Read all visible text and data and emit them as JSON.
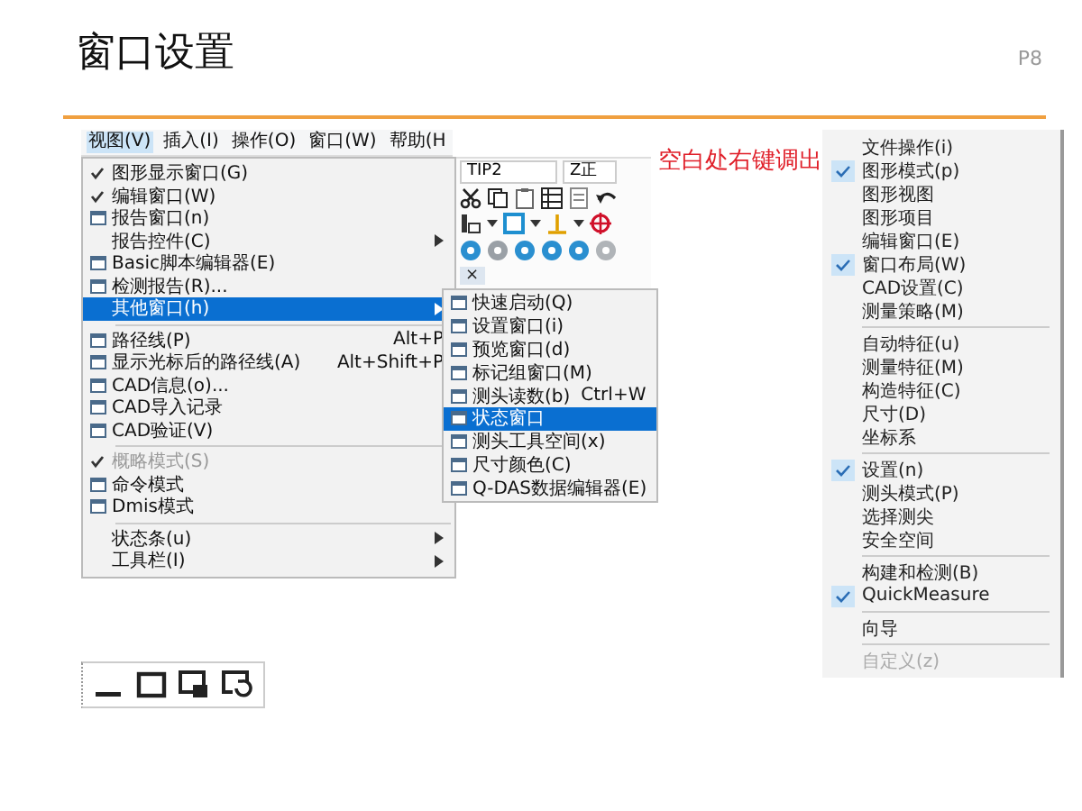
{
  "slide": {
    "title": "窗口设置",
    "page": "P8"
  },
  "app": {
    "menubar": [
      {
        "label": "视图(V)",
        "selected": true
      },
      {
        "label": "插入(I)",
        "selected": false
      },
      {
        "label": "操作(O)",
        "selected": false
      },
      {
        "label": "窗口(W)",
        "selected": false
      },
      {
        "label": "帮助(H",
        "selected": false
      }
    ],
    "toolbar": {
      "combo_1": "TIP2",
      "combo_2": "Z正",
      "close_tab": "×"
    },
    "view_menu": [
      {
        "kind": "item",
        "label": "图形显示窗口(G)",
        "checked": true,
        "selected": false,
        "disabled": false,
        "submenu": false
      },
      {
        "kind": "item",
        "label": "编辑窗口(W)",
        "checked": true,
        "selected": false,
        "disabled": false,
        "submenu": false
      },
      {
        "kind": "icon_item",
        "label": "报告窗口(n)",
        "checked": false,
        "selected": false,
        "disabled": false,
        "submenu": false
      },
      {
        "kind": "item",
        "label": "报告控件(C)",
        "checked": false,
        "selected": false,
        "disabled": false,
        "submenu": true
      },
      {
        "kind": "icon_item",
        "label": "Basic脚本编辑器(E)",
        "checked": false,
        "selected": false,
        "disabled": false,
        "submenu": false
      },
      {
        "kind": "icon_item",
        "label": "检测报告(R)...",
        "checked": false,
        "selected": false,
        "disabled": false,
        "submenu": false
      },
      {
        "kind": "item",
        "label": "其他窗口(h)",
        "checked": false,
        "selected": true,
        "disabled": false,
        "submenu": true
      },
      {
        "kind": "separator"
      },
      {
        "kind": "icon_item",
        "label": "路径线(P)",
        "shortcut": "Alt+P",
        "checked": false,
        "selected": false,
        "disabled": false,
        "submenu": false
      },
      {
        "kind": "icon_item",
        "label": "显示光标后的路径线(A)",
        "shortcut": "Alt+Shift+P",
        "checked": false,
        "selected": false,
        "disabled": false,
        "submenu": false
      },
      {
        "kind": "icon_item",
        "label": "CAD信息(o)...",
        "checked": false,
        "selected": false,
        "disabled": false,
        "submenu": false
      },
      {
        "kind": "icon_item",
        "label": "CAD导入记录",
        "checked": false,
        "selected": false,
        "disabled": false,
        "submenu": false
      },
      {
        "kind": "icon_item",
        "label": "CAD验证(V)",
        "checked": false,
        "selected": false,
        "disabled": false,
        "submenu": false
      },
      {
        "kind": "separator"
      },
      {
        "kind": "item",
        "label": "概略模式(S)",
        "checked": true,
        "selected": false,
        "disabled": true,
        "submenu": false
      },
      {
        "kind": "icon_item",
        "label": "命令模式",
        "checked": false,
        "selected": false,
        "disabled": false,
        "submenu": false
      },
      {
        "kind": "icon_item",
        "label": "Dmis模式",
        "checked": false,
        "selected": false,
        "disabled": false,
        "submenu": false
      },
      {
        "kind": "separator"
      },
      {
        "kind": "item",
        "label": "状态条(u)",
        "checked": false,
        "selected": false,
        "disabled": false,
        "submenu": true
      },
      {
        "kind": "item",
        "label": "工具栏(I)",
        "checked": false,
        "selected": false,
        "disabled": false,
        "submenu": true
      }
    ],
    "other_windows_menu": [
      {
        "label": "快速启动(Q)",
        "selected": false
      },
      {
        "label": "设置窗口(i)",
        "selected": false
      },
      {
        "label": "预览窗口(d)",
        "selected": false
      },
      {
        "label": "标记组窗口(M)",
        "selected": false
      },
      {
        "label": "测头读数(b)",
        "shortcut": "Ctrl+W",
        "selected": false
      },
      {
        "label": "状态窗口",
        "selected": true
      },
      {
        "label": "测头工具空间(x)",
        "selected": false
      },
      {
        "label": "尺寸颜色(C)",
        "selected": false
      },
      {
        "label": "Q-DAS数据编辑器(E)",
        "selected": false
      }
    ]
  },
  "callout": "空白处右键调出",
  "context_menu": [
    {
      "kind": "item",
      "label": "文件操作(i)",
      "checked": false,
      "disabled": false
    },
    {
      "kind": "item",
      "label": "图形模式(p)",
      "checked": true,
      "disabled": false
    },
    {
      "kind": "item",
      "label": "图形视图",
      "checked": false,
      "disabled": false
    },
    {
      "kind": "item",
      "label": "图形项目",
      "checked": false,
      "disabled": false
    },
    {
      "kind": "item",
      "label": "编辑窗口(E)",
      "checked": false,
      "disabled": false
    },
    {
      "kind": "item",
      "label": "窗口布局(W)",
      "checked": true,
      "disabled": false
    },
    {
      "kind": "item",
      "label": "CAD设置(C)",
      "checked": false,
      "disabled": false
    },
    {
      "kind": "item",
      "label": "测量策略(M)",
      "checked": false,
      "disabled": false
    },
    {
      "kind": "separator"
    },
    {
      "kind": "item",
      "label": "自动特征(u)",
      "checked": false,
      "disabled": false
    },
    {
      "kind": "item",
      "label": "测量特征(M)",
      "checked": false,
      "disabled": false
    },
    {
      "kind": "item",
      "label": "构造特征(C)",
      "checked": false,
      "disabled": false
    },
    {
      "kind": "item",
      "label": "尺寸(D)",
      "checked": false,
      "disabled": false
    },
    {
      "kind": "item",
      "label": "坐标系",
      "checked": false,
      "disabled": false
    },
    {
      "kind": "separator"
    },
    {
      "kind": "item",
      "label": "设置(n)",
      "checked": true,
      "disabled": false
    },
    {
      "kind": "item",
      "label": "测头模式(P)",
      "checked": false,
      "disabled": false
    },
    {
      "kind": "item",
      "label": "选择测尖",
      "checked": false,
      "disabled": false
    },
    {
      "kind": "item",
      "label": "安全空间",
      "checked": false,
      "disabled": false
    },
    {
      "kind": "separator"
    },
    {
      "kind": "item",
      "label": "构建和检测(B)",
      "checked": false,
      "disabled": false
    },
    {
      "kind": "item",
      "label": "QuickMeasure",
      "checked": true,
      "disabled": false
    },
    {
      "kind": "separator"
    },
    {
      "kind": "item",
      "label": "向导",
      "checked": false,
      "disabled": false
    },
    {
      "kind": "separator"
    },
    {
      "kind": "item",
      "label": "自定义(z)",
      "checked": false,
      "disabled": true
    }
  ]
}
